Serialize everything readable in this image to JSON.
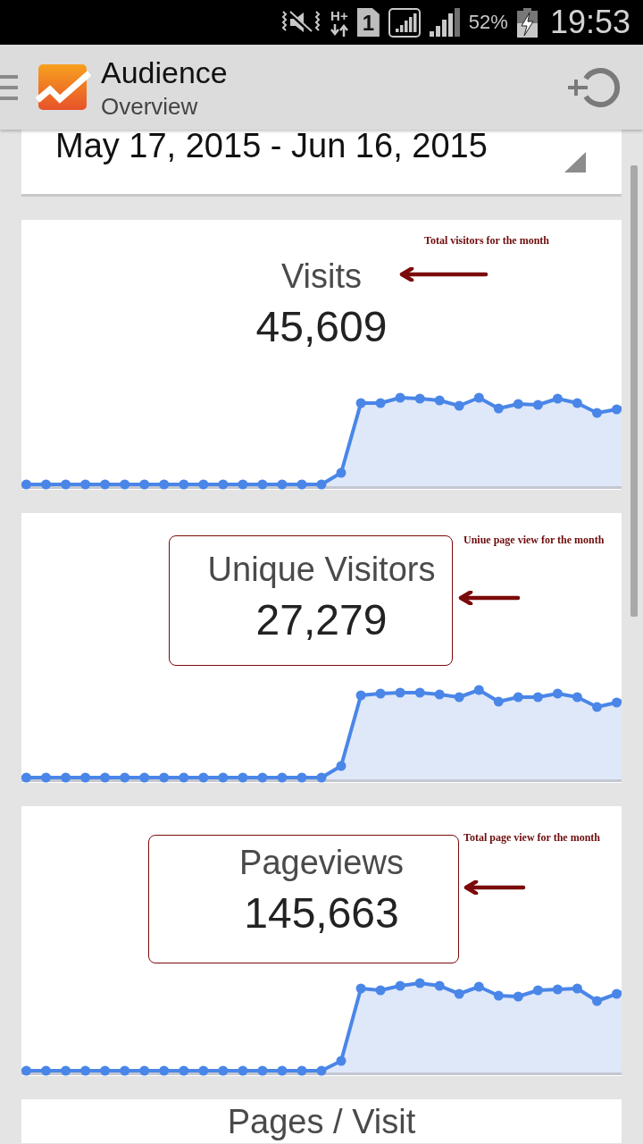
{
  "status_bar": {
    "network": "H+",
    "sim": "1",
    "battery": "52%",
    "time": "19:53"
  },
  "app_bar": {
    "title": "Audience",
    "subtitle": "Overview"
  },
  "date_range": {
    "value": "May 17, 2015 - Jun 16, 2015"
  },
  "metrics": [
    {
      "title": "Visits",
      "value": "45,609",
      "highlighted": false,
      "note": "Total visitors for the month"
    },
    {
      "title": "Unique Visitors",
      "value": "27,279",
      "highlighted": true,
      "note": "Uniue page view for the month"
    },
    {
      "title": "Pageviews",
      "value": "145,663",
      "highlighted": true,
      "note": "Total page view for the month"
    }
  ],
  "partial_metric": {
    "title": "Pages / Visit"
  }
}
